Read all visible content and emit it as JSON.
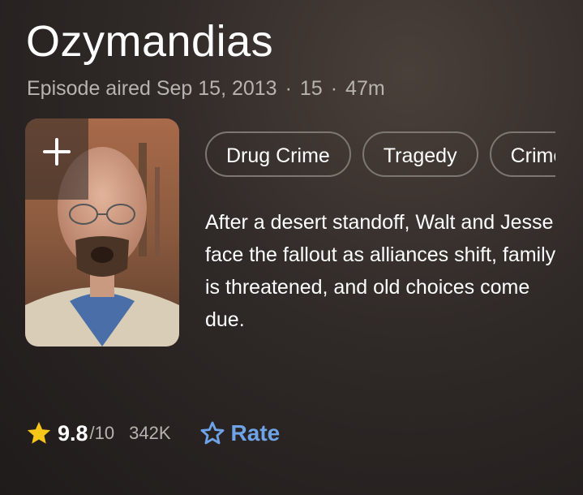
{
  "episode": {
    "title": "Ozymandias",
    "aired": "Episode aired Sep 15, 2013",
    "separator": "·",
    "rating_cert": "15",
    "runtime": "47m"
  },
  "poster": {
    "add_icon": "plus-icon"
  },
  "genres": [
    "Drug Crime",
    "Tragedy",
    "Crime"
  ],
  "description": "After a desert standoff, Walt and Jesse face the fallout as alliances shift, family is threatened, and old choices come due.",
  "rating": {
    "icon": "star-icon",
    "score": "9.8",
    "out_of": "/10",
    "votes": "342K",
    "rate_icon": "star-outline-icon",
    "rate_label": "Rate"
  },
  "colors": {
    "accent": "#6ea3e8",
    "star": "#f5c518",
    "muted_text": "#b8b3ae"
  }
}
